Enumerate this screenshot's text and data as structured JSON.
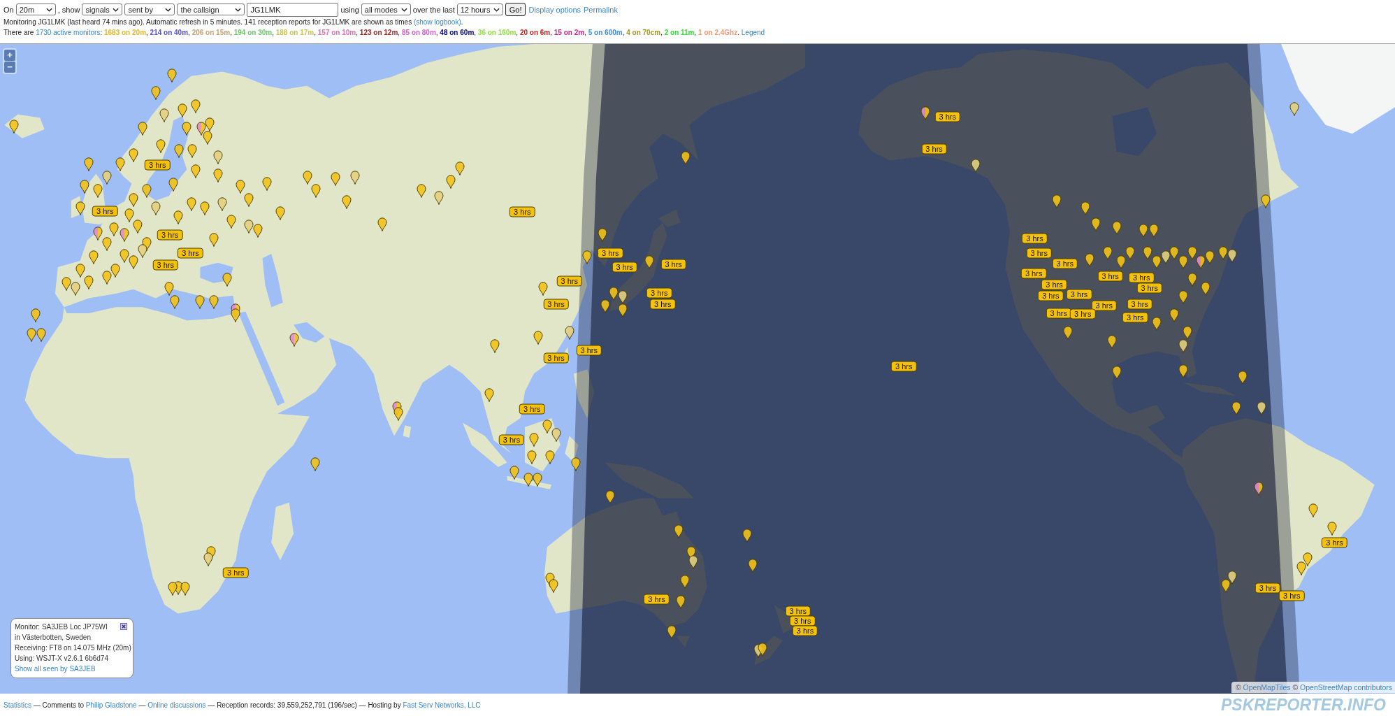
{
  "toolbar": [
    {
      "kind": "label",
      "text": "On"
    },
    {
      "kind": "select",
      "value": "20m"
    },
    {
      "kind": "label",
      "text": ", show"
    },
    {
      "kind": "select",
      "value": "signals"
    },
    {
      "kind": "select",
      "value": "sent by"
    },
    {
      "kind": "select",
      "value": "the callsign"
    },
    {
      "kind": "input",
      "value": "JG1LMK"
    },
    {
      "kind": "label",
      "text": "using"
    },
    {
      "kind": "select",
      "value": "all modes"
    },
    {
      "kind": "label",
      "text": "over the last"
    },
    {
      "kind": "select",
      "value": "12 hours"
    },
    {
      "kind": "button",
      "text": "Go!"
    },
    {
      "kind": "link",
      "text": "Display options"
    },
    {
      "kind": "link",
      "text": "Permalink"
    }
  ],
  "status_line": [
    {
      "kind": "text",
      "text": "Monitoring JG1LMK (last heard 74 mins ago). Automatic refresh in 5 minutes. 141 reception reports for JG1LMK are shown as times "
    },
    {
      "kind": "link",
      "text": "(show logbook)"
    },
    {
      "kind": "text",
      "text": "."
    }
  ],
  "monitor_line": [
    {
      "kind": "text",
      "text": "There are "
    },
    {
      "kind": "link",
      "text": "1730 active monitors"
    },
    {
      "kind": "text",
      "text": ": "
    },
    {
      "kind": "band",
      "text": "1683 on 20m",
      "color": "#e8b525"
    },
    {
      "kind": "text",
      "text": ", "
    },
    {
      "kind": "band",
      "text": "214 on 40m",
      "color": "#5050d8"
    },
    {
      "kind": "text",
      "text": ", "
    },
    {
      "kind": "band",
      "text": "206 on 15m",
      "color": "#c8a070"
    },
    {
      "kind": "text",
      "text": ", "
    },
    {
      "kind": "band",
      "text": "194 on 30m",
      "color": "#66cc66"
    },
    {
      "kind": "text",
      "text": ", "
    },
    {
      "kind": "band",
      "text": "188 on 17m",
      "color": "#ccc44a"
    },
    {
      "kind": "text",
      "text": ", "
    },
    {
      "kind": "band",
      "text": "157 on 10m",
      "color": "#e070b0"
    },
    {
      "kind": "text",
      "text": ", "
    },
    {
      "kind": "band",
      "text": "123 on 12m",
      "color": "#991f1f"
    },
    {
      "kind": "text",
      "text": ", "
    },
    {
      "kind": "band",
      "text": "85 on 80m",
      "color": "#d060d0"
    },
    {
      "kind": "text",
      "text": ", "
    },
    {
      "kind": "band",
      "text": "48 on 60m",
      "color": "#000080"
    },
    {
      "kind": "text",
      "text": ", "
    },
    {
      "kind": "band",
      "text": "36 on 160m",
      "color": "#90e040"
    },
    {
      "kind": "text",
      "text": ", "
    },
    {
      "kind": "band",
      "text": "20 on 6m",
      "color": "#cc2020"
    },
    {
      "kind": "text",
      "text": ", "
    },
    {
      "kind": "band",
      "text": "15 on 2m",
      "color": "#cc2288"
    },
    {
      "kind": "text",
      "text": ", "
    },
    {
      "kind": "band",
      "text": "5 on 600m",
      "color": "#3a8ee0"
    },
    {
      "kind": "text",
      "text": ", "
    },
    {
      "kind": "band",
      "text": "4 on 70cm",
      "color": "#a09820"
    },
    {
      "kind": "text",
      "text": ", "
    },
    {
      "kind": "band",
      "text": "2 on 11m",
      "color": "#33dd33"
    },
    {
      "kind": "text",
      "text": ", "
    },
    {
      "kind": "band",
      "text": "1 on 2.4Ghz",
      "color": "#ee9977"
    },
    {
      "kind": "text",
      "text": ". "
    },
    {
      "kind": "link",
      "text": "Legend"
    }
  ],
  "map": {
    "zoom_controls": [
      "+",
      "−"
    ],
    "time_labels": [
      {
        "text": "3 hrs"
      },
      {
        "text": "3 hrs"
      },
      {
        "text": "3 hrs"
      },
      {
        "text": "3 hrs"
      },
      {
        "text": "3 hrs"
      },
      {
        "text": "3 hrs"
      },
      {
        "text": "3 hrs"
      },
      {
        "text": "3 hrs"
      },
      {
        "text": "3 hrs"
      },
      {
        "text": "3 hrs"
      },
      {
        "text": "3 hrs"
      },
      {
        "text": "3 hrs"
      },
      {
        "text": "3 hrs"
      },
      {
        "text": "3 hrs"
      },
      {
        "text": "3 hrs"
      },
      {
        "text": "3 hrs"
      },
      {
        "text": "3 hrs"
      },
      {
        "text": "3 hrs"
      },
      {
        "text": "3 hrs"
      },
      {
        "text": "3 hrs"
      },
      {
        "text": "3 hrs"
      },
      {
        "text": "3 hrs"
      },
      {
        "text": "3 hrs"
      },
      {
        "text": "3 hrs"
      },
      {
        "text": "3 hrs"
      },
      {
        "text": "3 hrs"
      },
      {
        "text": "3 hrs"
      },
      {
        "text": "3 hrs"
      },
      {
        "text": "3 hrs"
      },
      {
        "text": "3 hrs"
      },
      {
        "text": "3 hrs"
      },
      {
        "text": "3 hrs"
      },
      {
        "text": "3 hrs"
      },
      {
        "text": "3 hrs"
      },
      {
        "text": "3 hrs"
      },
      {
        "text": "3 hrs"
      },
      {
        "text": "3 hrs"
      },
      {
        "text": "3 hrs"
      },
      {
        "text": "3 hrs"
      },
      {
        "text": "3 hrs"
      },
      {
        "text": "3 hrs"
      },
      {
        "text": "3 hrs"
      },
      {
        "text": "3 hrs"
      }
    ],
    "popup": {
      "lines": [
        "Monitor: SA3JEB Loc JP75WI",
        "in Västerbotten, Sweden",
        "Receiving: FT8 on 14.075 MHz (20m)",
        "Using: WSJT-X v2.6.1 6b6d74"
      ],
      "link": "Show all seen by SA3JEB"
    },
    "attribution": [
      {
        "kind": "text",
        "text": "© "
      },
      {
        "kind": "link",
        "text": "OpenMapTiles"
      },
      {
        "kind": "text",
        "text": " © "
      },
      {
        "kind": "link",
        "text": "OpenStreetMap contributors"
      }
    ]
  },
  "footer": [
    {
      "kind": "link",
      "text": "Statistics"
    },
    {
      "kind": "text",
      "text": " — Comments to "
    },
    {
      "kind": "link",
      "text": "Philip Gladstone"
    },
    {
      "kind": "text",
      "text": " — "
    },
    {
      "kind": "link",
      "text": "Online discussions"
    },
    {
      "kind": "text",
      "text": " — Reception records: 39,559,252,791 (196/sec) — Hosting by "
    },
    {
      "kind": "link",
      "text": "Fast Serv Networks, LLC"
    }
  ],
  "logo": "PSKREPORTER.INFO"
}
